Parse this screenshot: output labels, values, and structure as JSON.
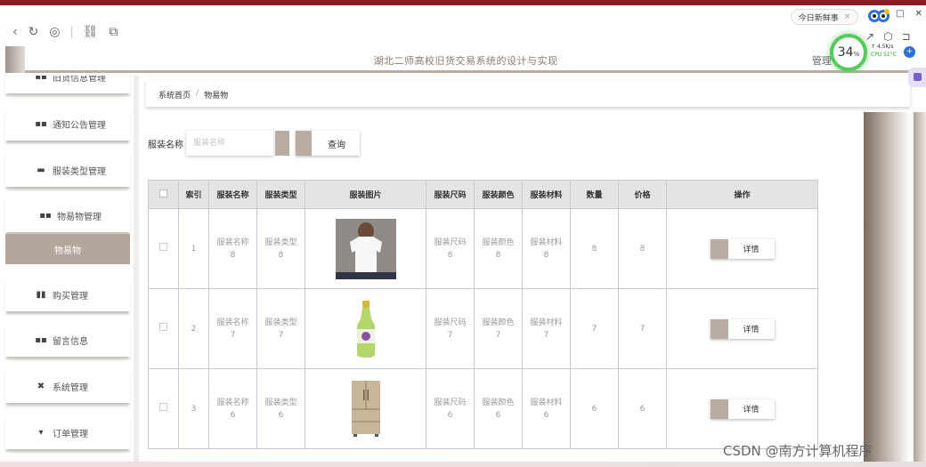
{
  "browser": {
    "news_label": "今日新鲜事",
    "perf_percent": "34",
    "perf_unit": "%",
    "net_speed": "4.5K/s",
    "cpu_label": "CPU 51°C"
  },
  "header": {
    "title": "湖北二师高校旧货交易系统的设计与实现",
    "admin": "管理"
  },
  "sidebar": {
    "items": [
      {
        "label": "旧货信息管理"
      },
      {
        "label": "通知公告管理"
      },
      {
        "label": "服装类型管理"
      },
      {
        "label": "物易物管理"
      },
      {
        "label": "物易物"
      },
      {
        "label": "购买管理"
      },
      {
        "label": "留言信息"
      },
      {
        "label": "系统管理"
      },
      {
        "label": "订单管理"
      }
    ]
  },
  "breadcrumb": {
    "home": "系统首页",
    "separator": "/",
    "current": "物易物"
  },
  "search": {
    "label": "服装名称",
    "placeholder": "服装名称",
    "button": "查询"
  },
  "table": {
    "headers": [
      "索引",
      "服装名称",
      "服装类型",
      "服装图片",
      "服装尺码",
      "服装颜色",
      "服装材料",
      "数量",
      "价格",
      "操作"
    ],
    "rows": [
      {
        "index": "1",
        "name_label": "服装名称",
        "name_num": "8",
        "type_label": "服装类型",
        "type_num": "8",
        "image": "white-tshirt",
        "size_label": "服装尺码",
        "size_num": "8",
        "color_label": "服装颜色",
        "color_num": "8",
        "material_label": "服装材料",
        "material_num": "8",
        "qty": "8",
        "price": "8",
        "action": "详情"
      },
      {
        "index": "2",
        "name_label": "服装名称",
        "name_num": "7",
        "type_label": "服装类型",
        "type_num": "7",
        "image": "drink-bottle",
        "size_label": "服装尺码",
        "size_num": "7",
        "color_label": "服装颜色",
        "color_num": "7",
        "material_label": "服装材料",
        "material_num": "7",
        "qty": "7",
        "price": "7",
        "action": "详情"
      },
      {
        "index": "3",
        "name_label": "服装名称",
        "name_num": "6",
        "type_label": "服装类型",
        "type_num": "6",
        "image": "refrigerator",
        "size_label": "服装尺码",
        "size_num": "6",
        "color_label": "服装颜色",
        "color_num": "6",
        "material_label": "服装材料",
        "material_num": "6",
        "qty": "6",
        "price": "6",
        "action": "详情"
      }
    ]
  },
  "watermark": "CSDN @南方计算机程序",
  "colors": {
    "accent": "#b8aca3",
    "top_strip": "#8d1f24",
    "perf_ring": "#58c95e"
  }
}
